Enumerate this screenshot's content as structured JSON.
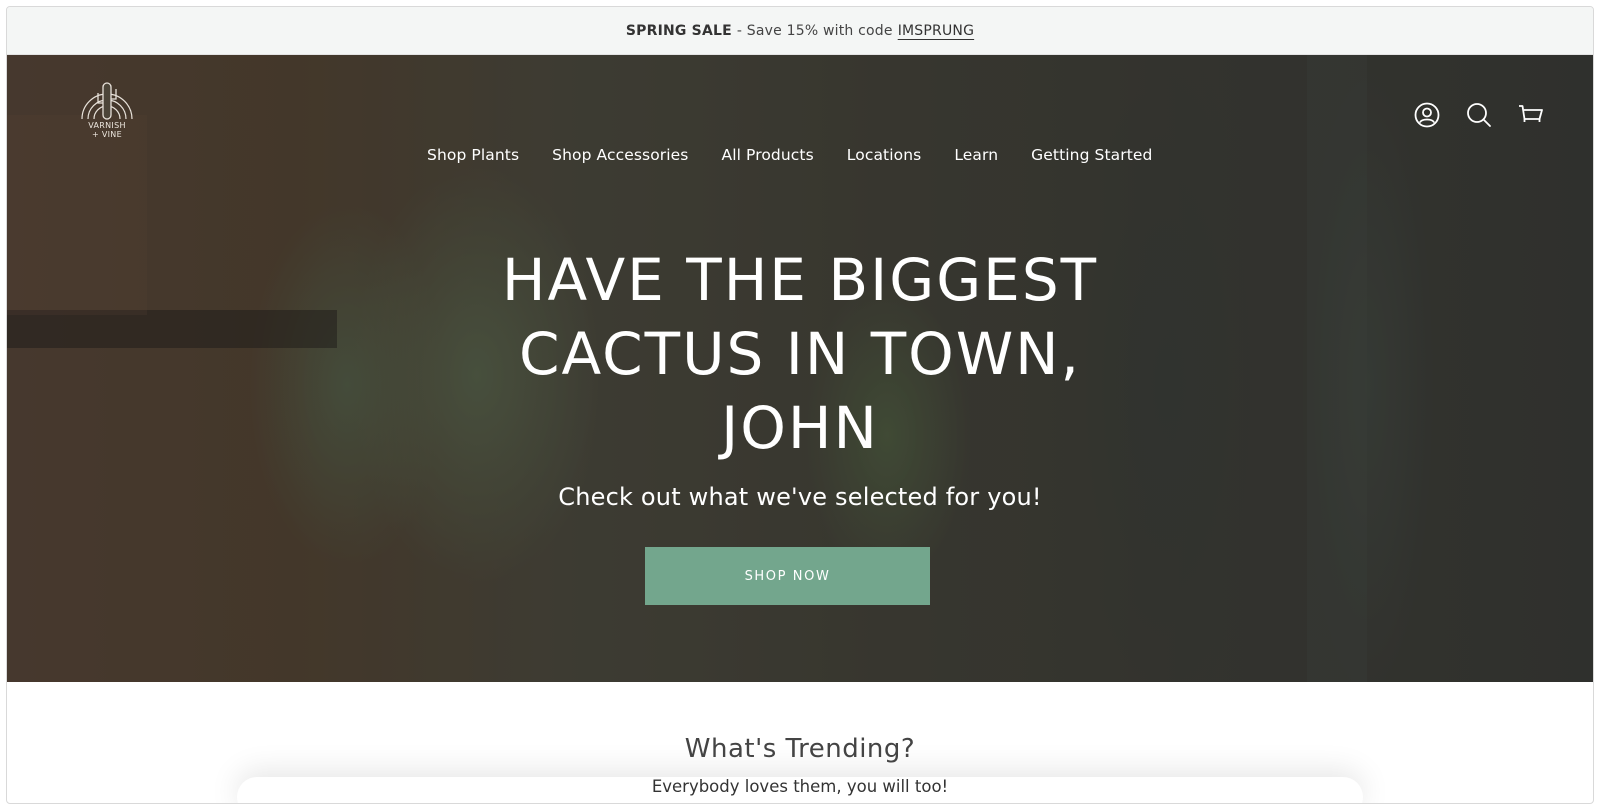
{
  "announcement": {
    "label": "SPRING SALE",
    "text": "- Save 15% with code",
    "code": "IMSPRUNG"
  },
  "brand": {
    "logo_text_line1": "VARNISH",
    "logo_text_line2": "+ VINE"
  },
  "nav": {
    "items": [
      {
        "label": "Shop Plants"
      },
      {
        "label": "Shop Accessories"
      },
      {
        "label": "All Products"
      },
      {
        "label": "Locations"
      },
      {
        "label": "Learn"
      },
      {
        "label": "Getting Started"
      }
    ],
    "icons": [
      "account-icon",
      "search-icon",
      "cart-icon"
    ]
  },
  "hero": {
    "title_lines": [
      "HAVE THE BIGGEST",
      "CACTUS IN TOWN,",
      "JOHN"
    ],
    "subtitle": "Check out what we've selected for you!",
    "cta_label": "SHOP NOW",
    "cta_color": "#73a68d"
  },
  "trending": {
    "heading": "What's Trending?",
    "subheading": "Everybody loves them, you will too!"
  }
}
